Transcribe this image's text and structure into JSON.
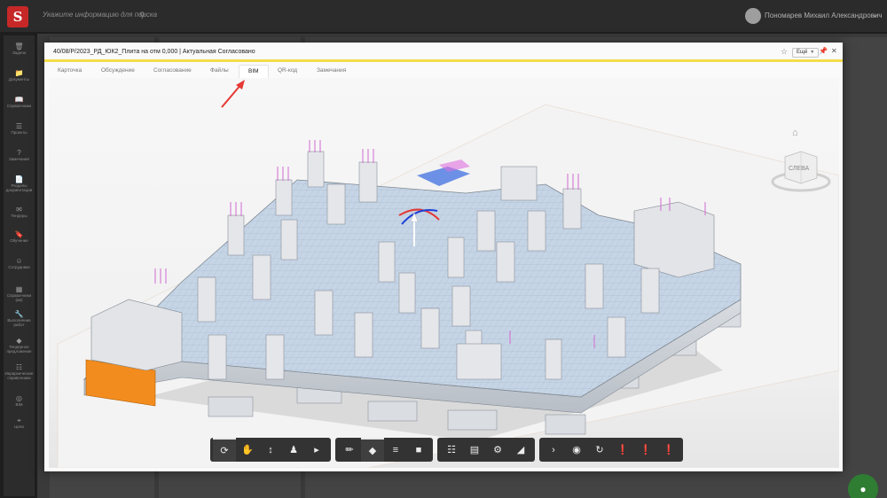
{
  "app": {
    "logo_letter": "S"
  },
  "search": {
    "placeholder": "Укажите информацию для поиска"
  },
  "user": {
    "name": "Пономарев Михаил Александрович"
  },
  "sidebar": {
    "items": [
      {
        "label": "Задачи",
        "icon": "trash-icon"
      },
      {
        "label": "Документы",
        "icon": "folder-icon"
      },
      {
        "label": "Справочники",
        "icon": "book-icon"
      },
      {
        "label": "Проекты",
        "icon": "list-icon"
      },
      {
        "label": "Замечания",
        "icon": "question-icon"
      },
      {
        "label": "Разделы документации",
        "icon": "file-icon"
      },
      {
        "label": "Тендеры",
        "icon": "envelope-icon"
      },
      {
        "label": "Обучение",
        "icon": "bookmark-icon"
      },
      {
        "label": "Сотрудники",
        "icon": "people-icon"
      },
      {
        "label": "Справочники (ии)",
        "icon": "grid-icon"
      },
      {
        "label": "Выполнение работ",
        "icon": "wrench-icon"
      },
      {
        "label": "Тендерное предложение",
        "icon": "eraser-icon"
      },
      {
        "label": "Иерархические справочники",
        "icon": "tree-icon"
      },
      {
        "label": "BIM",
        "icon": "compass-icon"
      },
      {
        "label": "Цели",
        "icon": "target-icon"
      }
    ]
  },
  "modal": {
    "title": "40/08/Р/2023_РД_ЮК2_Плита на отм 0,000 | Актуальная Согласовано",
    "more_label": "Ещё",
    "tabs": [
      {
        "label": "Карточка",
        "active": false
      },
      {
        "label": "Обсуждение",
        "active": false
      },
      {
        "label": "Согласование",
        "active": false
      },
      {
        "label": "Файлы",
        "active": false
      },
      {
        "label": "BIM",
        "active": true
      },
      {
        "label": "QR-код",
        "active": false
      },
      {
        "label": "Замечания",
        "active": false
      }
    ]
  },
  "viewcube": {
    "label": "СЛЕВА"
  },
  "toolbar": {
    "groups": [
      [
        "orbit-icon",
        "pan-hand-icon",
        "zoom-icon",
        "first-person-icon",
        "camera-icon"
      ],
      [
        "measure-icon",
        "section-icon",
        "layers-icon",
        "box-icon"
      ],
      [
        "model-tree-icon",
        "properties-icon",
        "settings-icon",
        "fullscreen-icon"
      ],
      [
        "chevron-right-icon",
        "eye-icon",
        "refresh-icon",
        "alert-icon",
        "alert-icon",
        "alert-icon"
      ]
    ]
  },
  "colors": {
    "accent": "#f2dd4a",
    "brand": "#c62828",
    "chat": "#2e7d32",
    "annotation": "#e53935"
  }
}
